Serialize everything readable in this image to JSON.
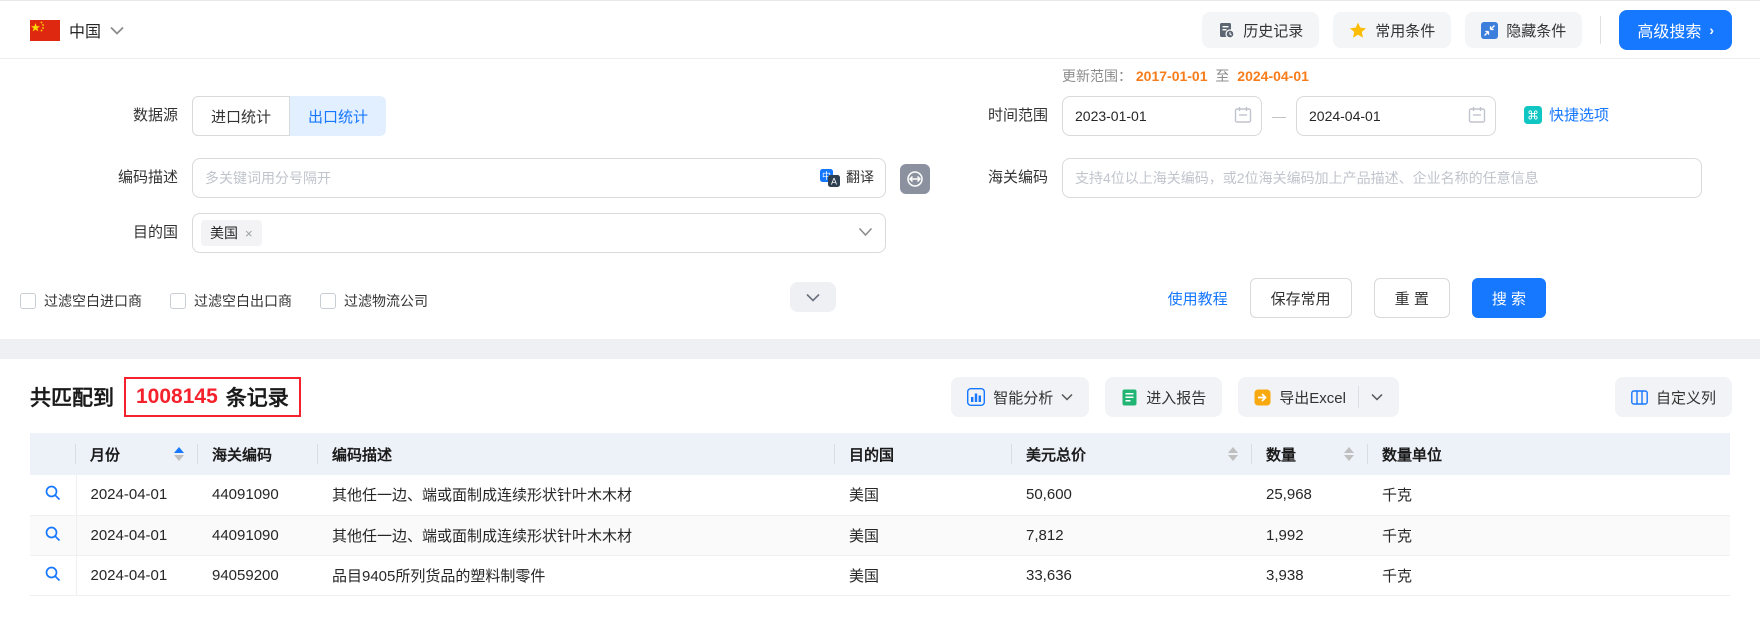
{
  "topbar": {
    "country": "中国",
    "history_button": "历史记录",
    "favorites_button": "常用条件",
    "hide_conditions_button": "隐藏条件",
    "advanced_search_button": "高级搜索",
    "advanced_search_chevron": "›"
  },
  "form": {
    "update_range": {
      "label": "更新范围：",
      "start": "2017-01-01",
      "to": "至",
      "end": "2024-04-01"
    },
    "data_source": {
      "label": "数据源",
      "options": [
        "进口统计",
        "出口统计"
      ],
      "selected": "出口统计"
    },
    "date_range": {
      "label": "时间范围",
      "start": "2023-01-01",
      "end": "2024-04-01",
      "separator": "—",
      "quick_options": "快捷选项"
    },
    "code_description": {
      "label": "编码描述",
      "placeholder": "多关键词用分号隔开",
      "translate_label": "翻译"
    },
    "hs_code": {
      "label": "海关编码",
      "placeholder": "支持4位以上海关编码，或2位海关编码加上产品描述、企业名称的任意信息"
    },
    "destination": {
      "label": "目的国",
      "tag": "美国",
      "tag_close": "×"
    },
    "filters": [
      "过滤空白进口商",
      "过滤空白出口商",
      "过滤物流公司"
    ],
    "tutorial_link": "使用教程",
    "save_button": "保存常用",
    "reset_button": "重 置",
    "search_button": "搜 索"
  },
  "results": {
    "match_prefix": "共匹配到",
    "match_count": "1008145",
    "match_suffix": "条记录",
    "analysis_button": "智能分析",
    "report_button": "进入报告",
    "export_button": "导出Excel",
    "custom_columns_button": "自定义列"
  },
  "table": {
    "headers": [
      "月份",
      "海关编码",
      "编码描述",
      "目的国",
      "美元总价",
      "数量",
      "数量单位"
    ],
    "rows": [
      {
        "month": "2024-04-01",
        "hs_code": "44091090",
        "description": "其他任一边、端或面制成连续形状针叶木木材",
        "destination": "美国",
        "usd_total": "50,600",
        "quantity": "25,968",
        "unit": "千克"
      },
      {
        "month": "2024-04-01",
        "hs_code": "44091090",
        "description": "其他任一边、端或面制成连续形状针叶木木材",
        "destination": "美国",
        "usd_total": "7,812",
        "quantity": "1,992",
        "unit": "千克"
      },
      {
        "month": "2024-04-01",
        "hs_code": "94059200",
        "description": "品目9405所列货品的塑料制零件",
        "destination": "美国",
        "usd_total": "33,636",
        "quantity": "3,938",
        "unit": "千克"
      }
    ]
  },
  "colors": {
    "primary_blue": "#1677ff",
    "selected_tab_bg": "#e2efff",
    "orange_dates": "#f77c1b",
    "count_red": "#f5222d",
    "star_gold": "#fbbd08",
    "teal_icon": "#0fc6c2",
    "report_green": "#21b573",
    "excel_orange": "#f8a90f",
    "header_bg": "#edf1f8"
  }
}
